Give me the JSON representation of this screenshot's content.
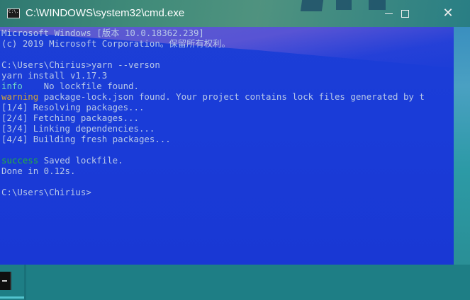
{
  "window": {
    "title": "C:\\WINDOWS\\system32\\cmd.exe",
    "icon": "cmd-icon",
    "icon_label": "C:\\."
  },
  "controls": {
    "minimize_icon": "minimize-icon",
    "maximize_icon": "maximize-icon",
    "close_icon": "close-icon",
    "close_glyph": "✕"
  },
  "console": {
    "lines": [
      "Microsoft Windows [版本 10.0.18362.239]",
      "(c) 2019 Microsoft Corporation。保留所有权利。",
      "",
      "C:\\Users\\Chirius>yarn --verson",
      "yarn install v1.17.3",
      "    No lockfile found.",
      "package-lock.json found. Your project contains lock files generated by t",
      "[1/4] Resolving packages...",
      "[2/4] Fetching packages...",
      "[3/4] Linking dependencies...",
      "[4/4] Building fresh packages...",
      "",
      "Saved lockfile.",
      "Done in 0.12s.",
      "",
      "C:\\Users\\Chirius>"
    ],
    "prefix_info": "info",
    "prefix_warning": "warning",
    "prefix_success": "success"
  },
  "colors": {
    "console_bg": "#1c3ed6",
    "text": "#b8c8e8",
    "warning": "#d1a33a",
    "success": "#25b33a",
    "info": "#6fd0c8"
  },
  "taskbar": {
    "item_icon": "cmd-taskbar-icon"
  }
}
